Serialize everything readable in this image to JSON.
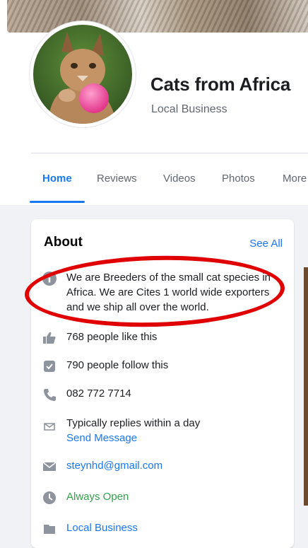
{
  "page": {
    "name": "Cats from Africa",
    "category": "Local Business"
  },
  "tabs": [
    {
      "label": "Home",
      "active": true
    },
    {
      "label": "Reviews",
      "active": false
    },
    {
      "label": "Videos",
      "active": false
    },
    {
      "label": "Photos",
      "active": false
    },
    {
      "label": "More",
      "active": false
    }
  ],
  "about": {
    "title": "About",
    "see_all": "See All",
    "description_lines": [
      "We are Breeders of the small cat species in",
      "Africa. We are Cites 1 world wide exporters",
      "and we ship all over the world."
    ],
    "likes": "768 people like this",
    "follows": "790 people follow this",
    "phone": "082 772 7714",
    "response": "Typically replies within a day",
    "send_message": "Send Message",
    "email": "steynhd@gmail.com",
    "hours": "Always Open",
    "category_link": "Local Business"
  },
  "colors": {
    "accent": "#1877f2",
    "open_green": "#31a24c",
    "annotation_red": "#e00000"
  }
}
